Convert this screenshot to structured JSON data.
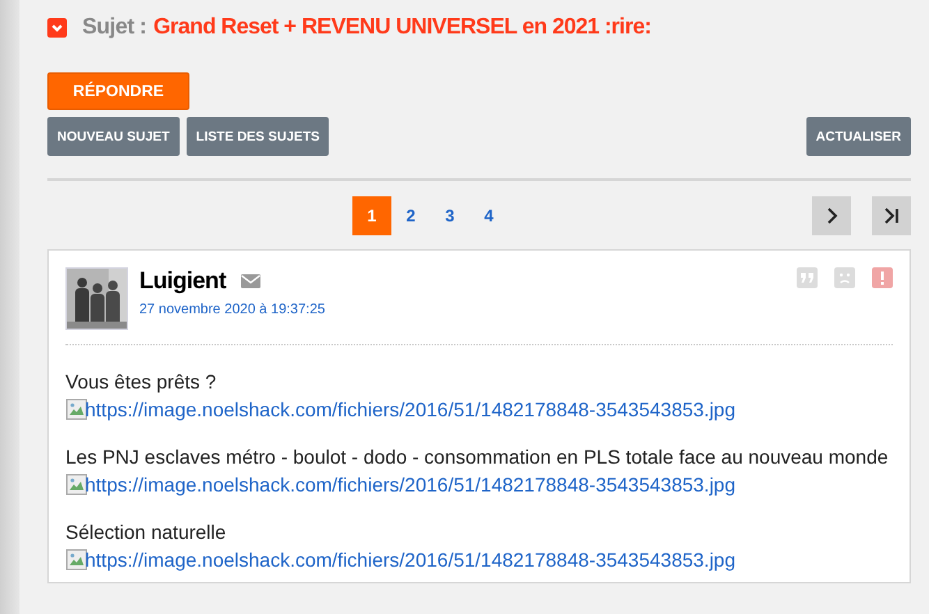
{
  "topic": {
    "label": "Sujet :",
    "title": "Grand Reset + REVENU UNIVERSEL en 2021 :rire:"
  },
  "reply_button": "RÉPONDRE",
  "actions_left": [
    "NOUVEAU SUJET",
    "LISTE DES SUJETS"
  ],
  "actions_right": [
    "ACTUALISER"
  ],
  "pages": [
    {
      "label": "1",
      "selected": true
    },
    {
      "label": "2",
      "selected": false
    },
    {
      "label": "3",
      "selected": false
    },
    {
      "label": "4",
      "selected": false
    }
  ],
  "post": {
    "author": "Luigient",
    "date": "27 novembre 2020 à 19:37:25",
    "paragraphs": [
      {
        "text": "Vous êtes prêts ?",
        "link": "https://image.noelshack.com/fichiers/2016/51/1482178848-3543543853.jpg"
      },
      {
        "text": "Les PNJ esclaves métro - boulot - dodo - consommation en PLS totale face au nouveau monde",
        "link": "https://image.noelshack.com/fichiers/2016/51/1482178848-3543543853.jpg"
      },
      {
        "text": "Sélection naturelle",
        "link": "https://image.noelshack.com/fichiers/2016/51/1482178848-3543543853.jpg"
      }
    ]
  }
}
